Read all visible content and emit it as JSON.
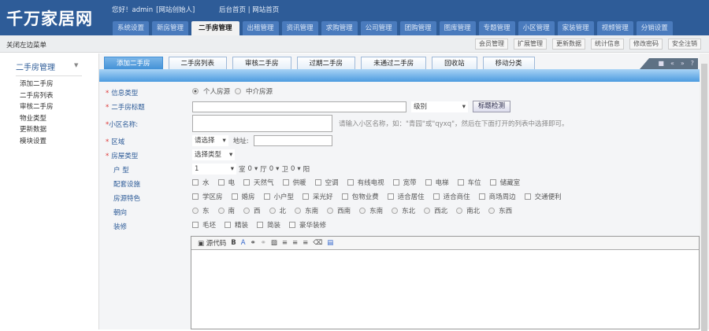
{
  "header": {
    "logo": "千万家居网",
    "welcome": "您好！admin",
    "role": "[网站创始人]",
    "links": [
      "后台首页",
      "|",
      "网站首页"
    ]
  },
  "nav": [
    "系统设置",
    "新房管理",
    "二手房管理",
    "出租管理",
    "资讯管理",
    "求购管理",
    "公司管理",
    "团购管理",
    "图库管理",
    "专题管理",
    "小区管理",
    "家装管理",
    "视频管理",
    "分销设置"
  ],
  "nav_active": 2,
  "bar2": {
    "close_menu": "关闭左边菜单",
    "quick": [
      "会员管理",
      "扩展管理",
      "更新数据",
      "统计信息",
      "修改密码",
      "安全注销"
    ]
  },
  "sidebar": {
    "title": "二手房管理",
    "items": [
      "添加二手房",
      "二手房列表",
      "审核二手房",
      "物业类型",
      "更新数据",
      "模块设置"
    ]
  },
  "tabs": [
    "添加二手房",
    "二手房列表",
    "审核二手房",
    "过期二手房",
    "未通过二手房",
    "回收站",
    "移动分类"
  ],
  "tab_tools": [
    "■",
    "«",
    "»",
    "?"
  ],
  "form": {
    "info_type": {
      "label": "信息类型",
      "options": [
        "个人房源",
        "中介房源"
      ],
      "selected": 0
    },
    "title": {
      "label": "二手房标题",
      "level": "级别",
      "check_button": "标题检测"
    },
    "community": {
      "label": "小区名称:",
      "hint": "请输入小区名称，如：\"青园\"或\"qyxq\"，然后在下面打开的列表中选择即可。"
    },
    "area": {
      "label": "区域",
      "select": "请选择",
      "addr_label": "地址:"
    },
    "house_type": {
      "label": "房屋类型",
      "select": "选择类型"
    },
    "layout": {
      "label": "户 型",
      "room": "1",
      "room_unit": "室",
      "hall": "0",
      "hall_unit": "厅",
      "bath": "0",
      "bath_unit": "卫",
      "balcony": "0",
      "balcony_unit": "阳"
    },
    "facilities": {
      "label": "配套设施",
      "options": [
        "水",
        "电",
        "天然气",
        "供暖",
        "空调",
        "有线电视",
        "宽带",
        "电梯",
        "车位",
        "储藏室"
      ]
    },
    "features": {
      "label": "房源特色",
      "options": [
        "学区房",
        "婚房",
        "小户型",
        "采光好",
        "包物业费",
        "适合居住",
        "适合商住",
        "商场周边",
        "交通便利"
      ]
    },
    "orientation": {
      "label": "朝向",
      "options": [
        "东",
        "南",
        "西",
        "北",
        "东南",
        "西南",
        "东南",
        "东北",
        "西北",
        "南北",
        "东西"
      ]
    },
    "decoration": {
      "label": "装修",
      "options": [
        "毛坯",
        "精装",
        "简装",
        "豪华装修"
      ]
    }
  },
  "editor": {
    "source": "源代码",
    "bold": "B",
    "font": "A"
  }
}
